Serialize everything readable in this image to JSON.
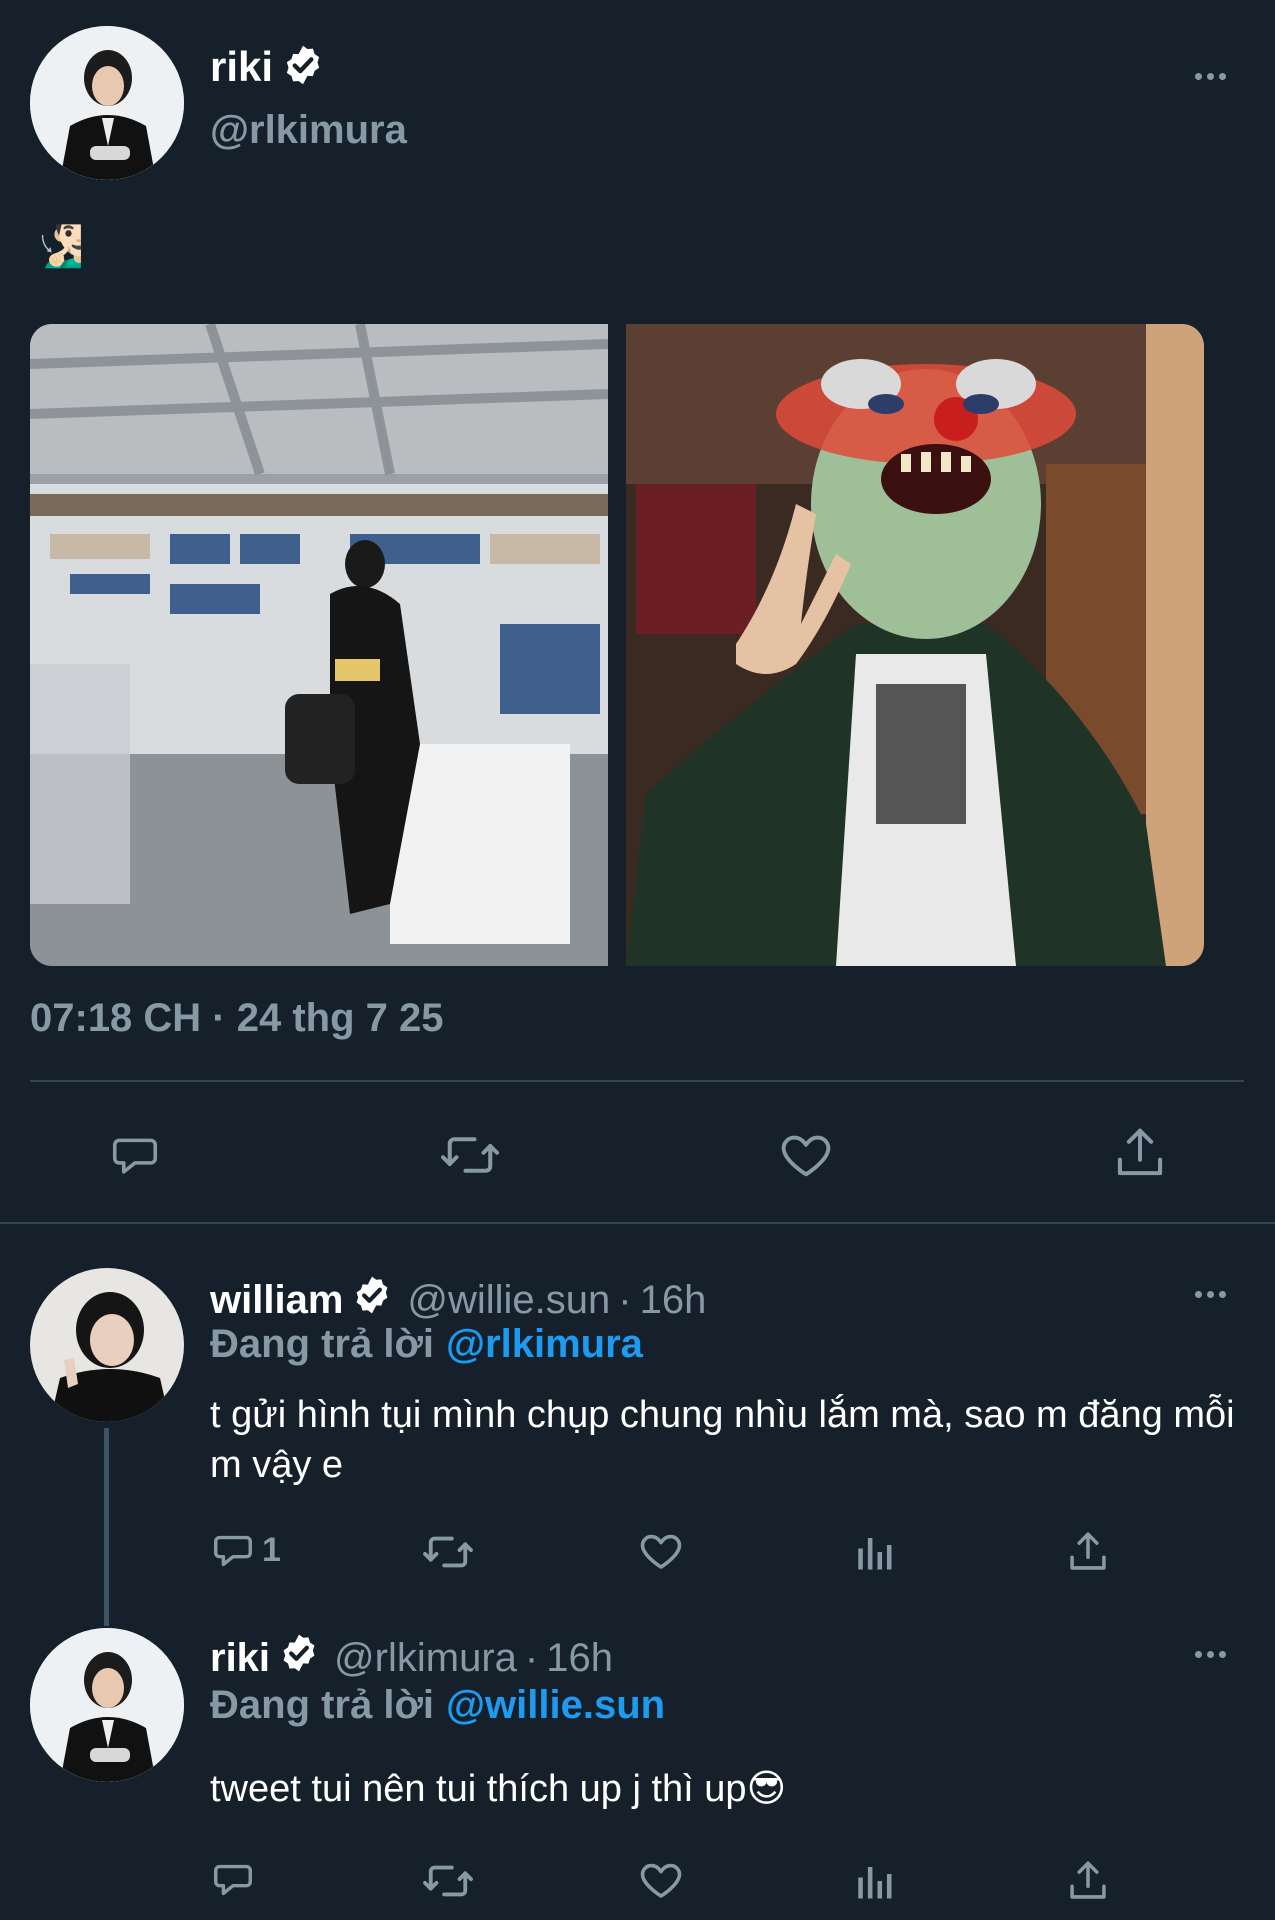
{
  "main_tweet": {
    "author": {
      "display_name": "riki",
      "handle": "@rlkimura",
      "verified": true
    },
    "text_emoji": "🧏🏻‍♂️",
    "media": [
      {
        "description_icon": "record-store-photo"
      },
      {
        "description_icon": "clown-mask-photo"
      }
    ],
    "timestamp": "07:18 CH · 24 thg 7 25",
    "actions": {
      "reply_icon": "reply-icon",
      "retweet_icon": "retweet-icon",
      "like_icon": "heart-icon",
      "share_icon": "share-icon"
    }
  },
  "replies": [
    {
      "author": {
        "display_name": "william",
        "handle": "@willie.sun",
        "verified": true
      },
      "separator": "·",
      "time": "16h",
      "replying_label": "Đang trả lời",
      "replying_to": "@rlkimura",
      "text": "t gửi hình tụi mình chụp chung nhìu lắm mà, sao m đăng mỗi m vậy e",
      "reply_count": "1"
    },
    {
      "author": {
        "display_name": "riki",
        "handle": "@rlkimura",
        "verified": true
      },
      "separator": "·",
      "time": "16h",
      "replying_label": "Đang trả lời",
      "replying_to": "@willie.sun",
      "text": "tweet tui nên tui thích up j thì up😎",
      "reply_count": ""
    }
  ],
  "colors": {
    "background": "#15202b",
    "muted": "#8899a6",
    "link": "#1d9bf0",
    "divider": "#38444d"
  }
}
